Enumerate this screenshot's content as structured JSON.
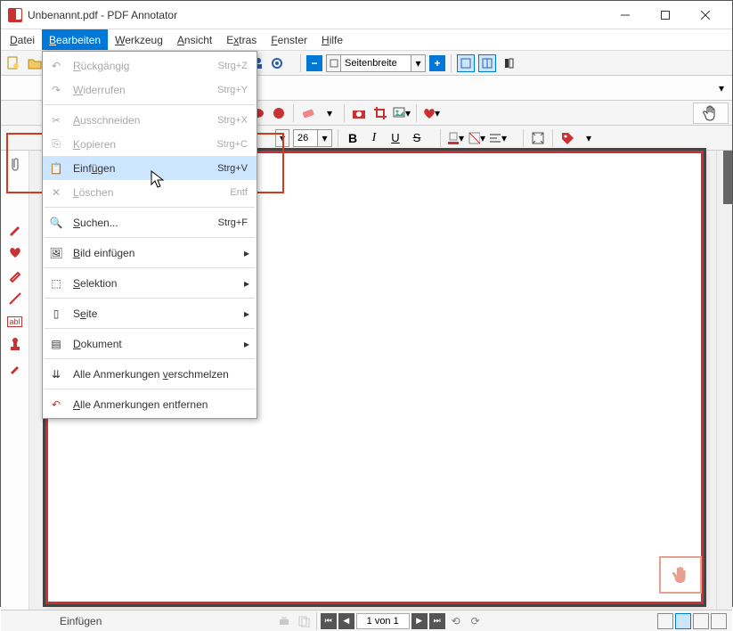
{
  "window": {
    "title": "Unbenannt.pdf - PDF Annotator"
  },
  "menubar": {
    "items": [
      "Datei",
      "Bearbeiten",
      "Werkzeug",
      "Ansicht",
      "Extras",
      "Fenster",
      "Hilfe"
    ],
    "active_index": 1
  },
  "dropdown": {
    "items": [
      {
        "label": "Rückgängig",
        "shortcut": "Strg+Z",
        "disabled": true,
        "icon": "undo"
      },
      {
        "label": "Widerrufen",
        "shortcut": "Strg+Y",
        "disabled": true,
        "icon": "redo"
      },
      {
        "sep": true
      },
      {
        "label": "Ausschneiden",
        "shortcut": "Strg+X",
        "disabled": true,
        "icon": "cut"
      },
      {
        "label": "Kopieren",
        "shortcut": "Strg+C",
        "disabled": true,
        "icon": "copy"
      },
      {
        "label": "Einfügen",
        "shortcut": "Strg+V",
        "disabled": false,
        "icon": "paste",
        "hover": true
      },
      {
        "label": "Löschen",
        "shortcut": "Entf",
        "disabled": true,
        "icon": "delete"
      },
      {
        "sep": true
      },
      {
        "label": "Suchen...",
        "shortcut": "Strg+F",
        "disabled": false,
        "icon": "search"
      },
      {
        "sep": true
      },
      {
        "label": "Bild einfügen",
        "submenu": true,
        "icon": "image"
      },
      {
        "sep": true
      },
      {
        "label": "Selektion",
        "submenu": true,
        "icon": "select"
      },
      {
        "sep": true
      },
      {
        "label": "Seite",
        "submenu": true,
        "icon": "page"
      },
      {
        "sep": true
      },
      {
        "label": "Dokument",
        "submenu": true,
        "icon": "document"
      },
      {
        "sep": true
      },
      {
        "label": "Alle Anmerkungen verschmelzen",
        "icon": "merge"
      },
      {
        "sep": true
      },
      {
        "label": "Alle Anmerkungen entfernen",
        "icon": "remove-all"
      }
    ]
  },
  "toolbar1": {
    "zoom_label": "Seitenbreite"
  },
  "toolbar3": {
    "font_size": "26"
  },
  "statusbar": {
    "text": "Einfügen",
    "page": "1 von 1"
  }
}
